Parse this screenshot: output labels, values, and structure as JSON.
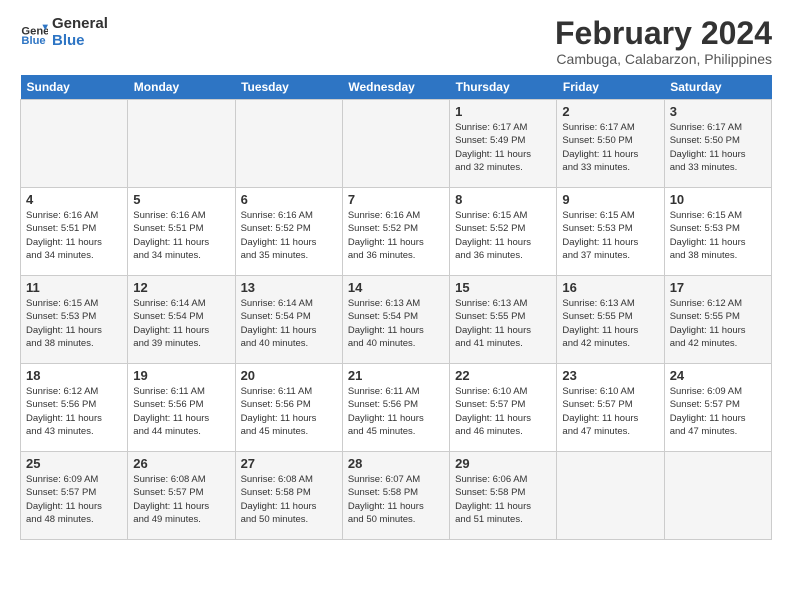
{
  "logo": {
    "line1": "General",
    "line2": "Blue"
  },
  "title": "February 2024",
  "location": "Cambuga, Calabarzon, Philippines",
  "days_header": [
    "Sunday",
    "Monday",
    "Tuesday",
    "Wednesday",
    "Thursday",
    "Friday",
    "Saturday"
  ],
  "weeks": [
    [
      {
        "num": "",
        "info": ""
      },
      {
        "num": "",
        "info": ""
      },
      {
        "num": "",
        "info": ""
      },
      {
        "num": "",
        "info": ""
      },
      {
        "num": "1",
        "info": "Sunrise: 6:17 AM\nSunset: 5:49 PM\nDaylight: 11 hours\nand 32 minutes."
      },
      {
        "num": "2",
        "info": "Sunrise: 6:17 AM\nSunset: 5:50 PM\nDaylight: 11 hours\nand 33 minutes."
      },
      {
        "num": "3",
        "info": "Sunrise: 6:17 AM\nSunset: 5:50 PM\nDaylight: 11 hours\nand 33 minutes."
      }
    ],
    [
      {
        "num": "4",
        "info": "Sunrise: 6:16 AM\nSunset: 5:51 PM\nDaylight: 11 hours\nand 34 minutes."
      },
      {
        "num": "5",
        "info": "Sunrise: 6:16 AM\nSunset: 5:51 PM\nDaylight: 11 hours\nand 34 minutes."
      },
      {
        "num": "6",
        "info": "Sunrise: 6:16 AM\nSunset: 5:52 PM\nDaylight: 11 hours\nand 35 minutes."
      },
      {
        "num": "7",
        "info": "Sunrise: 6:16 AM\nSunset: 5:52 PM\nDaylight: 11 hours\nand 36 minutes."
      },
      {
        "num": "8",
        "info": "Sunrise: 6:15 AM\nSunset: 5:52 PM\nDaylight: 11 hours\nand 36 minutes."
      },
      {
        "num": "9",
        "info": "Sunrise: 6:15 AM\nSunset: 5:53 PM\nDaylight: 11 hours\nand 37 minutes."
      },
      {
        "num": "10",
        "info": "Sunrise: 6:15 AM\nSunset: 5:53 PM\nDaylight: 11 hours\nand 38 minutes."
      }
    ],
    [
      {
        "num": "11",
        "info": "Sunrise: 6:15 AM\nSunset: 5:53 PM\nDaylight: 11 hours\nand 38 minutes."
      },
      {
        "num": "12",
        "info": "Sunrise: 6:14 AM\nSunset: 5:54 PM\nDaylight: 11 hours\nand 39 minutes."
      },
      {
        "num": "13",
        "info": "Sunrise: 6:14 AM\nSunset: 5:54 PM\nDaylight: 11 hours\nand 40 minutes."
      },
      {
        "num": "14",
        "info": "Sunrise: 6:13 AM\nSunset: 5:54 PM\nDaylight: 11 hours\nand 40 minutes."
      },
      {
        "num": "15",
        "info": "Sunrise: 6:13 AM\nSunset: 5:55 PM\nDaylight: 11 hours\nand 41 minutes."
      },
      {
        "num": "16",
        "info": "Sunrise: 6:13 AM\nSunset: 5:55 PM\nDaylight: 11 hours\nand 42 minutes."
      },
      {
        "num": "17",
        "info": "Sunrise: 6:12 AM\nSunset: 5:55 PM\nDaylight: 11 hours\nand 42 minutes."
      }
    ],
    [
      {
        "num": "18",
        "info": "Sunrise: 6:12 AM\nSunset: 5:56 PM\nDaylight: 11 hours\nand 43 minutes."
      },
      {
        "num": "19",
        "info": "Sunrise: 6:11 AM\nSunset: 5:56 PM\nDaylight: 11 hours\nand 44 minutes."
      },
      {
        "num": "20",
        "info": "Sunrise: 6:11 AM\nSunset: 5:56 PM\nDaylight: 11 hours\nand 45 minutes."
      },
      {
        "num": "21",
        "info": "Sunrise: 6:11 AM\nSunset: 5:56 PM\nDaylight: 11 hours\nand 45 minutes."
      },
      {
        "num": "22",
        "info": "Sunrise: 6:10 AM\nSunset: 5:57 PM\nDaylight: 11 hours\nand 46 minutes."
      },
      {
        "num": "23",
        "info": "Sunrise: 6:10 AM\nSunset: 5:57 PM\nDaylight: 11 hours\nand 47 minutes."
      },
      {
        "num": "24",
        "info": "Sunrise: 6:09 AM\nSunset: 5:57 PM\nDaylight: 11 hours\nand 47 minutes."
      }
    ],
    [
      {
        "num": "25",
        "info": "Sunrise: 6:09 AM\nSunset: 5:57 PM\nDaylight: 11 hours\nand 48 minutes."
      },
      {
        "num": "26",
        "info": "Sunrise: 6:08 AM\nSunset: 5:57 PM\nDaylight: 11 hours\nand 49 minutes."
      },
      {
        "num": "27",
        "info": "Sunrise: 6:08 AM\nSunset: 5:58 PM\nDaylight: 11 hours\nand 50 minutes."
      },
      {
        "num": "28",
        "info": "Sunrise: 6:07 AM\nSunset: 5:58 PM\nDaylight: 11 hours\nand 50 minutes."
      },
      {
        "num": "29",
        "info": "Sunrise: 6:06 AM\nSunset: 5:58 PM\nDaylight: 11 hours\nand 51 minutes."
      },
      {
        "num": "",
        "info": ""
      },
      {
        "num": "",
        "info": ""
      }
    ]
  ]
}
